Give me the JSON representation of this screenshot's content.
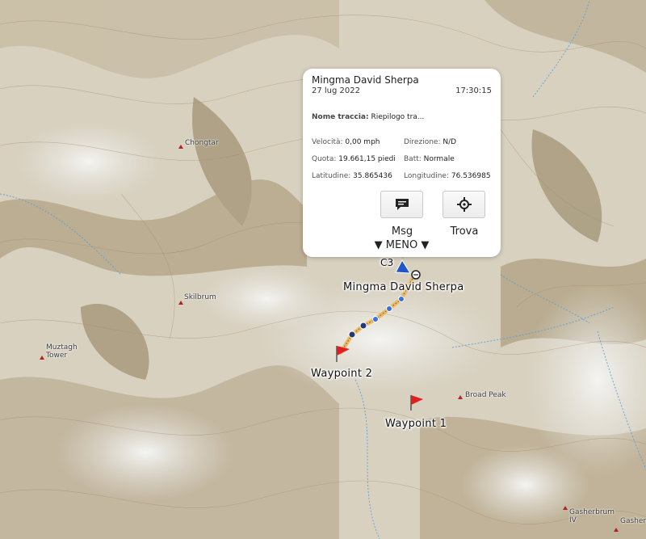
{
  "map": {
    "peaks": [
      {
        "id": "chongtar",
        "label": "Chongtar"
      },
      {
        "id": "skilbrum",
        "label": "Skilbrum"
      },
      {
        "id": "muztagh",
        "label": "Muztagh\nTower"
      },
      {
        "id": "broad-peak",
        "label": "Broad Peak"
      },
      {
        "id": "gasherbrum-iv",
        "label": "Gasherbrum\nIV"
      },
      {
        "id": "gasher",
        "label": "Gasher"
      }
    ],
    "track_label": "Mingma David Sherpa",
    "checkpoint_label": "C3",
    "waypoints": [
      "Waypoint 2",
      "Waypoint 1"
    ],
    "colors": {
      "track": "#f5b642",
      "marker": "#2255cc",
      "flag": "#e02020"
    }
  },
  "popup": {
    "name": "Mingma David Sherpa",
    "date": "27 lug 2022",
    "time": "17:30:15",
    "track_key": "Nome traccia:",
    "track_value": "Riepilogo tra...",
    "speed_key": "Velocità:",
    "speed_value": "0,00 mph",
    "direction_key": "Direzione:",
    "direction_value": "N/D",
    "altitude_key": "Quota:",
    "altitude_value": "19.661,15 piedi",
    "battery_key": "Batt:",
    "battery_value": "Normale",
    "lat_key": "Latitudine:",
    "lat_value": "35.865436",
    "lon_key": "Longitudine:",
    "lon_value": "76.536985",
    "msg_icon": "message-icon",
    "msg_label": "Msg",
    "find_icon": "crosshair-icon",
    "find_label": "Trova",
    "less_label": "▼ MENO ▼"
  }
}
